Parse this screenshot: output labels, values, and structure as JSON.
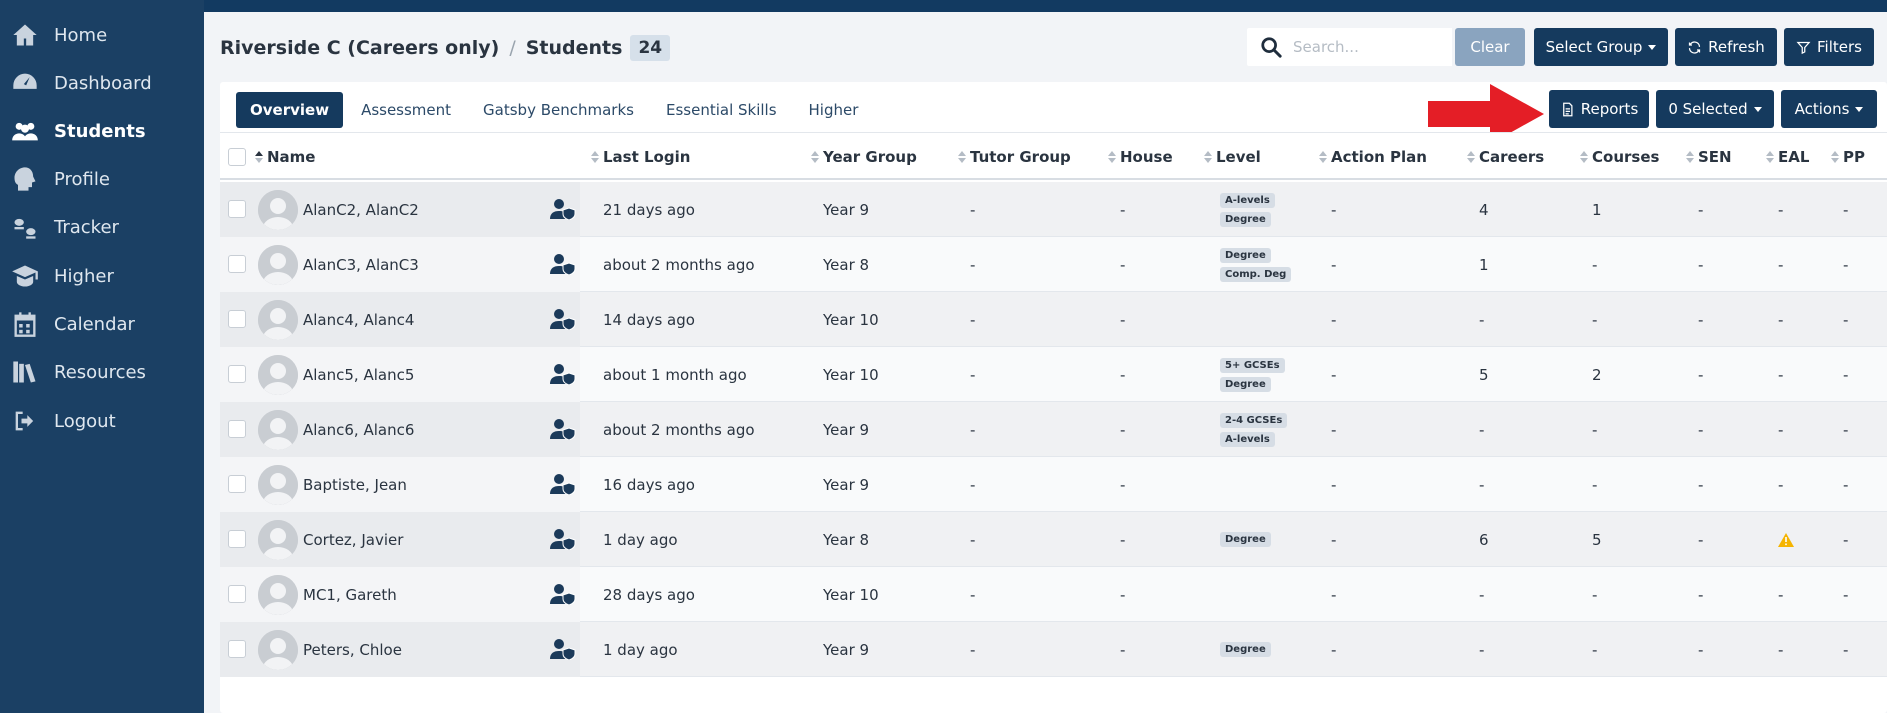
{
  "sidebar": {
    "items": [
      {
        "label": "Home",
        "icon": "home-icon",
        "active": false
      },
      {
        "label": "Dashboard",
        "icon": "dashboard-icon",
        "active": false
      },
      {
        "label": "Students",
        "icon": "students-icon",
        "active": true
      },
      {
        "label": "Profile",
        "icon": "profile-icon",
        "active": false
      },
      {
        "label": "Tracker",
        "icon": "tracker-icon",
        "active": false
      },
      {
        "label": "Higher",
        "icon": "graduation-cap-icon",
        "active": false
      },
      {
        "label": "Calendar",
        "icon": "calendar-icon",
        "active": false
      },
      {
        "label": "Resources",
        "icon": "resources-icon",
        "active": false
      },
      {
        "label": "Logout",
        "icon": "logout-icon",
        "active": false
      }
    ]
  },
  "header": {
    "school": "Riverside C (Careers only)",
    "separator": "/",
    "section": "Students",
    "count": "24"
  },
  "toolbar": {
    "search_placeholder": "Search...",
    "clear_label": "Clear",
    "select_group_label": "Select Group",
    "refresh_label": "Refresh",
    "filters_label": "Filters",
    "reports_label": "Reports",
    "selected_label": "0 Selected",
    "actions_label": "Actions"
  },
  "tabs": [
    "Overview",
    "Assessment",
    "Gatsby Benchmarks",
    "Essential Skills",
    "Higher"
  ],
  "columns": [
    "Name",
    "Last Login",
    "Year Group",
    "Tutor Group",
    "House",
    "Level",
    "Action Plan",
    "Careers",
    "Courses",
    "SEN",
    "EAL",
    "PP"
  ],
  "rows": [
    {
      "name": "AlanC2, AlanC2",
      "last_login": "21 days ago",
      "year": "Year 9",
      "tutor": "-",
      "house": "-",
      "levels": [
        "A-levels",
        "Degree"
      ],
      "action_plan": "-",
      "careers": "4",
      "courses": "1",
      "sen": "-",
      "eal": "-",
      "pp": "-"
    },
    {
      "name": "AlanC3, AlanC3",
      "last_login": "about 2 months ago",
      "year": "Year 8",
      "tutor": "-",
      "house": "-",
      "levels": [
        "Degree",
        "Comp. Deg"
      ],
      "action_plan": "-",
      "careers": "1",
      "courses": "-",
      "sen": "-",
      "eal": "-",
      "pp": "-"
    },
    {
      "name": "Alanc4, Alanc4",
      "last_login": "14 days ago",
      "year": "Year 10",
      "tutor": "-",
      "house": "-",
      "levels": [],
      "action_plan": "-",
      "careers": "-",
      "courses": "-",
      "sen": "-",
      "eal": "-",
      "pp": "-"
    },
    {
      "name": "Alanc5, Alanc5",
      "last_login": "about 1 month ago",
      "year": "Year 10",
      "tutor": "-",
      "house": "-",
      "levels": [
        "5+ GCSEs",
        "Degree"
      ],
      "action_plan": "-",
      "careers": "5",
      "courses": "2",
      "sen": "-",
      "eal": "-",
      "pp": "-"
    },
    {
      "name": "Alanc6, Alanc6",
      "last_login": "about 2 months ago",
      "year": "Year 9",
      "tutor": "-",
      "house": "-",
      "levels": [
        "2-4 GCSEs",
        "A-levels"
      ],
      "action_plan": "-",
      "careers": "-",
      "courses": "-",
      "sen": "-",
      "eal": "-",
      "pp": "-"
    },
    {
      "name": "Baptiste, Jean",
      "last_login": "16 days ago",
      "year": "Year 9",
      "tutor": "-",
      "house": "-",
      "levels": [],
      "action_plan": "-",
      "careers": "-",
      "courses": "-",
      "sen": "-",
      "eal": "-",
      "pp": "-"
    },
    {
      "name": "Cortez, Javier",
      "last_login": "1 day ago",
      "year": "Year 8",
      "tutor": "-",
      "house": "-",
      "levels": [
        "Degree"
      ],
      "action_plan": "-",
      "careers": "6",
      "courses": "5",
      "sen": "-",
      "eal": "warning-icon",
      "pp": "-"
    },
    {
      "name": "MC1, Gareth",
      "last_login": "28 days ago",
      "year": "Year 10",
      "tutor": "-",
      "house": "-",
      "levels": [],
      "action_plan": "-",
      "careers": "-",
      "courses": "-",
      "sen": "-",
      "eal": "-",
      "pp": "-"
    },
    {
      "name": "Peters, Chloe",
      "last_login": "1 day ago",
      "year": "Year 9",
      "tutor": "-",
      "house": "-",
      "levels": [
        "Degree"
      ],
      "action_plan": "-",
      "careers": "-",
      "courses": "-",
      "sen": "-",
      "eal": "-",
      "pp": "-"
    }
  ],
  "colors": {
    "sidebar_bg": "#1b4064",
    "primary": "#153a5e",
    "clear_btn": "#8aa4bf",
    "arrow": "#e41e26",
    "warning": "#f5b400"
  }
}
